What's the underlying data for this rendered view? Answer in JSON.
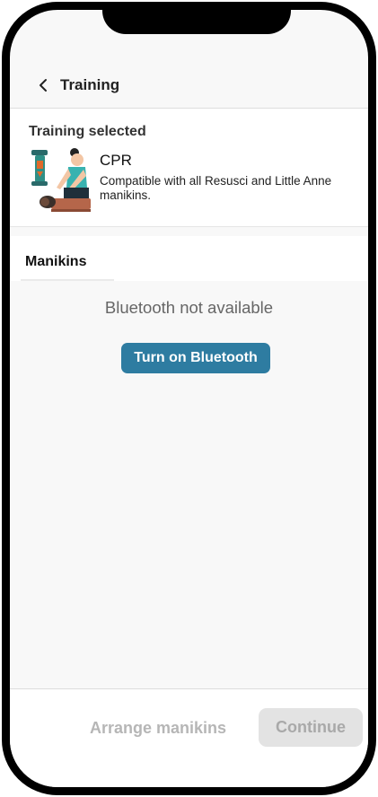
{
  "header": {
    "title": "Training"
  },
  "training": {
    "selected_label": "Training selected",
    "name": "CPR",
    "description": "Compatible with all Resusci and Little Anne manikins."
  },
  "manikins": {
    "tab_label": "Manikins",
    "bluetooth_status": "Bluetooth not available",
    "bluetooth_button": "Turn on Bluetooth"
  },
  "footer": {
    "arrange_label": "Arrange manikins",
    "continue_label": "Continue"
  },
  "colors": {
    "accent": "#2e7ca1",
    "disabled_bg": "#e3e3e3",
    "disabled_text": "#a9a9a9"
  },
  "icons": {
    "back": "chevron-left-icon",
    "illustration": "cpr-illustration"
  }
}
